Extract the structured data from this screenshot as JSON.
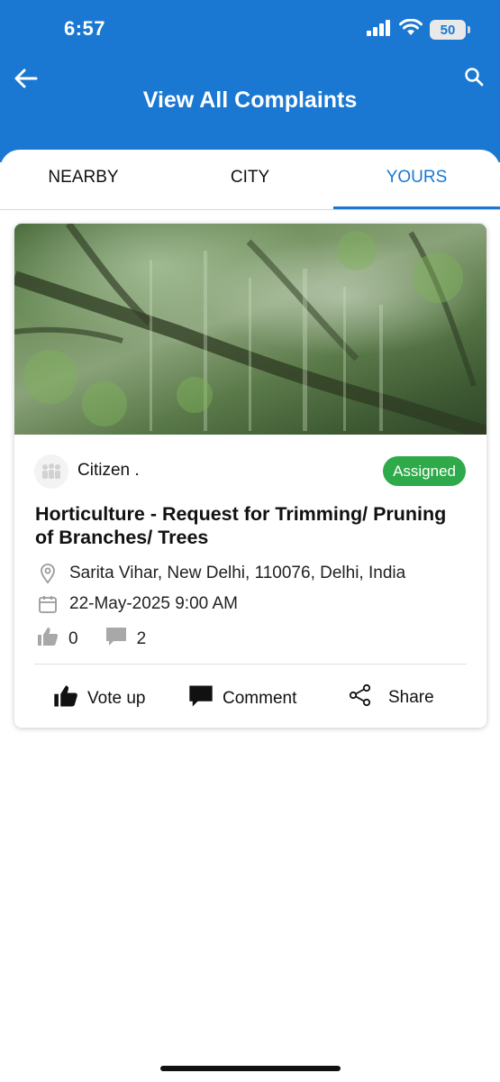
{
  "status_bar": {
    "time": "6:57",
    "battery": "50"
  },
  "header": {
    "title": "View All Complaints"
  },
  "tabs": [
    {
      "label": "NEARBY",
      "active": false
    },
    {
      "label": "CITY",
      "active": false
    },
    {
      "label": "YOURS",
      "active": true
    }
  ],
  "complaint": {
    "author": "Citizen .",
    "status": "Assigned",
    "title": "Horticulture - Request for Trimming/ Pruning of Branches/ Trees",
    "location": "Sarita Vihar, New Delhi, 110076, Delhi, India",
    "date": "22-May-2025 9:00 AM",
    "votes": "0",
    "comments": "2",
    "actions": {
      "vote_label": "Vote up",
      "comment_label": "Comment",
      "share_label": "Share"
    }
  },
  "colors": {
    "primary": "#1a78d2",
    "status_assigned": "#2eaa4a"
  },
  "icons": [
    "back-arrow-icon",
    "search-icon",
    "signal-icon",
    "wifi-icon",
    "location-pin-icon",
    "calendar-icon",
    "thumbs-up-icon",
    "comment-icon",
    "share-icon"
  ]
}
